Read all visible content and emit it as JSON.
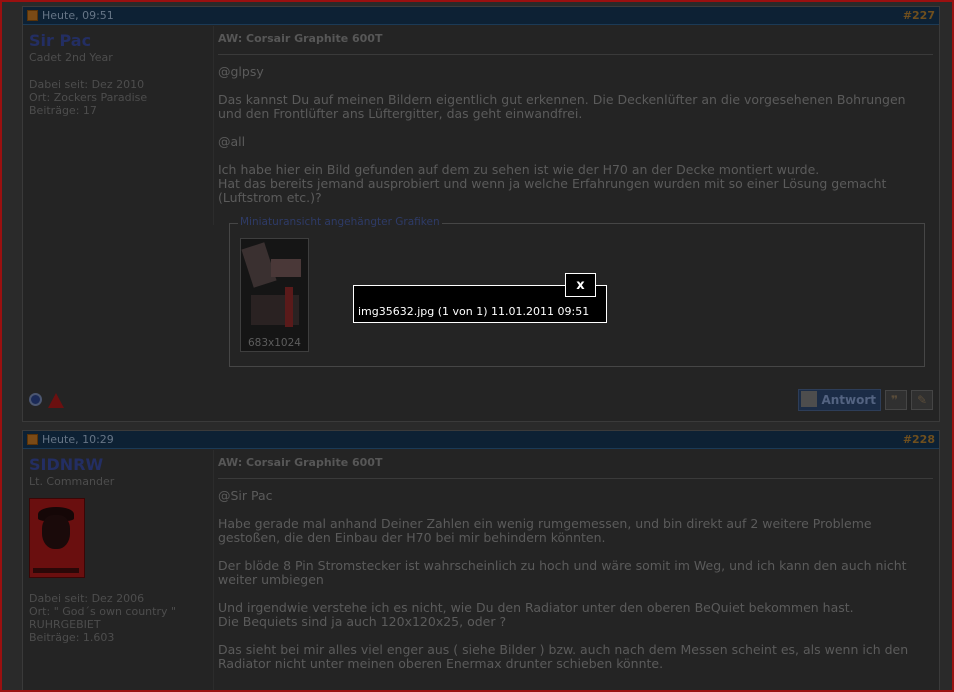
{
  "posts": [
    {
      "date": "Heute, 09:51",
      "number": "#227",
      "username": "Sir Pac",
      "usertitle": "Cadet 2nd Year",
      "joined": "Dabei seit: Dez 2010",
      "location": "Ort: Zockers Paradise",
      "posts": "Beiträge: 17",
      "title": "AW: Corsair Graphite 600T",
      "paragraphs": [
        "@glpsy",
        "Das kannst Du auf meinen Bildern eigentlich gut erkennen. Die Deckenlüfter an die vorgesehenen Bohrungen und den Frontlüfter ans Lüftergitter, das geht einwandfrei.",
        "@all",
        "Ich habe hier ein Bild gefunden auf dem zu sehen ist wie der H70 an der Decke montiert wurde.\nHat das bereits jemand ausprobiert und wenn ja welche Erfahrungen wurden mit so einer Lösung gemacht (Luftstrom etc.)?"
      ],
      "attachments_legend": "Miniaturansicht angehängter Grafiken",
      "thumb_label": "683x1024",
      "reply_label": "Antwort"
    },
    {
      "date": "Heute, 10:29",
      "number": "#228",
      "username": "SIDNRW",
      "usertitle": "Lt. Commander",
      "joined": "Dabei seit: Dez 2006",
      "location": "Ort: \" God´s own country \"",
      "location2": "RUHRGEBIET",
      "posts": "Beiträge: 1.603",
      "title": "AW: Corsair Graphite 600T",
      "paragraphs": [
        "@Sir Pac",
        "Habe gerade mal anhand Deiner Zahlen ein wenig rumgemessen, und bin direkt auf 2 weitere Probleme gestoßen, die den Einbau der H70 bei mir behindern könnten.",
        "Der blöde 8 Pin Stromstecker ist wahrscheinlich zu hoch und wäre somit im Weg, und ich kann den auch nicht weiter umbiegen",
        "Und irgendwie verstehe ich es nicht, wie Du den Radiator unter den oberen BeQuiet bekommen hast.\nDie Bequiets sind ja auch 120x120x25, oder ?",
        "Das sieht bei mir alles viel enger aus ( siehe Bilder ) bzw. auch nach dem Messen scheint es, als wenn ich den Radiator nicht unter meinen oberen Enermax drunter schieben könnte."
      ]
    }
  ],
  "popup": {
    "close_label": "x",
    "caption": "img35632.jpg (1 von 1)  11.01.2011 09:51"
  }
}
